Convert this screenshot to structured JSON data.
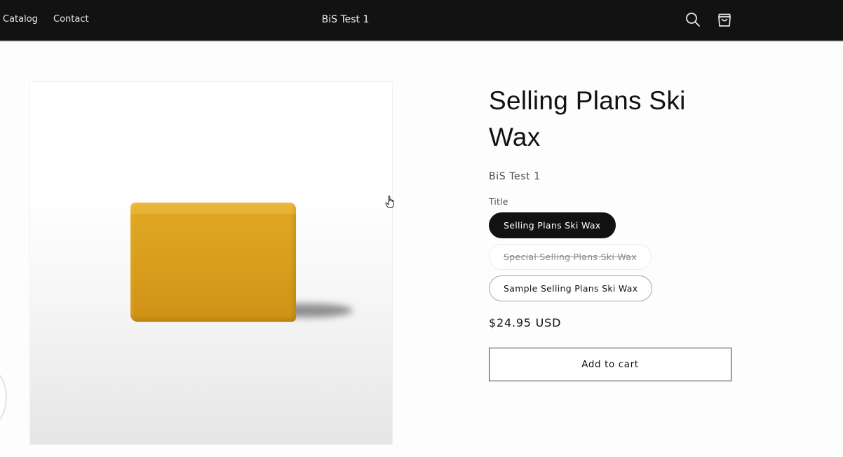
{
  "header": {
    "nav_items": [
      "Catalog",
      "Contact"
    ],
    "store_name": "BiS Test 1",
    "icons": [
      "search-icon",
      "cart-icon"
    ]
  },
  "product": {
    "title": "Selling Plans Ski Wax",
    "vendor": "BiS Test 1",
    "option_label": "Title",
    "options": [
      {
        "label": "Selling Plans Ski Wax",
        "state": "selected"
      },
      {
        "label": "Special Selling Plans Ski Wax",
        "state": "unavailable"
      },
      {
        "label": "Sample Selling Plans Ski Wax",
        "state": "available"
      }
    ],
    "price": "$24.95 USD",
    "add_to_cart_label": "Add to cart"
  },
  "colors": {
    "header_bg": "#121212",
    "page_bg": "#fdfdfd",
    "wax_color": "#d89d1b",
    "accent": "#121212"
  }
}
